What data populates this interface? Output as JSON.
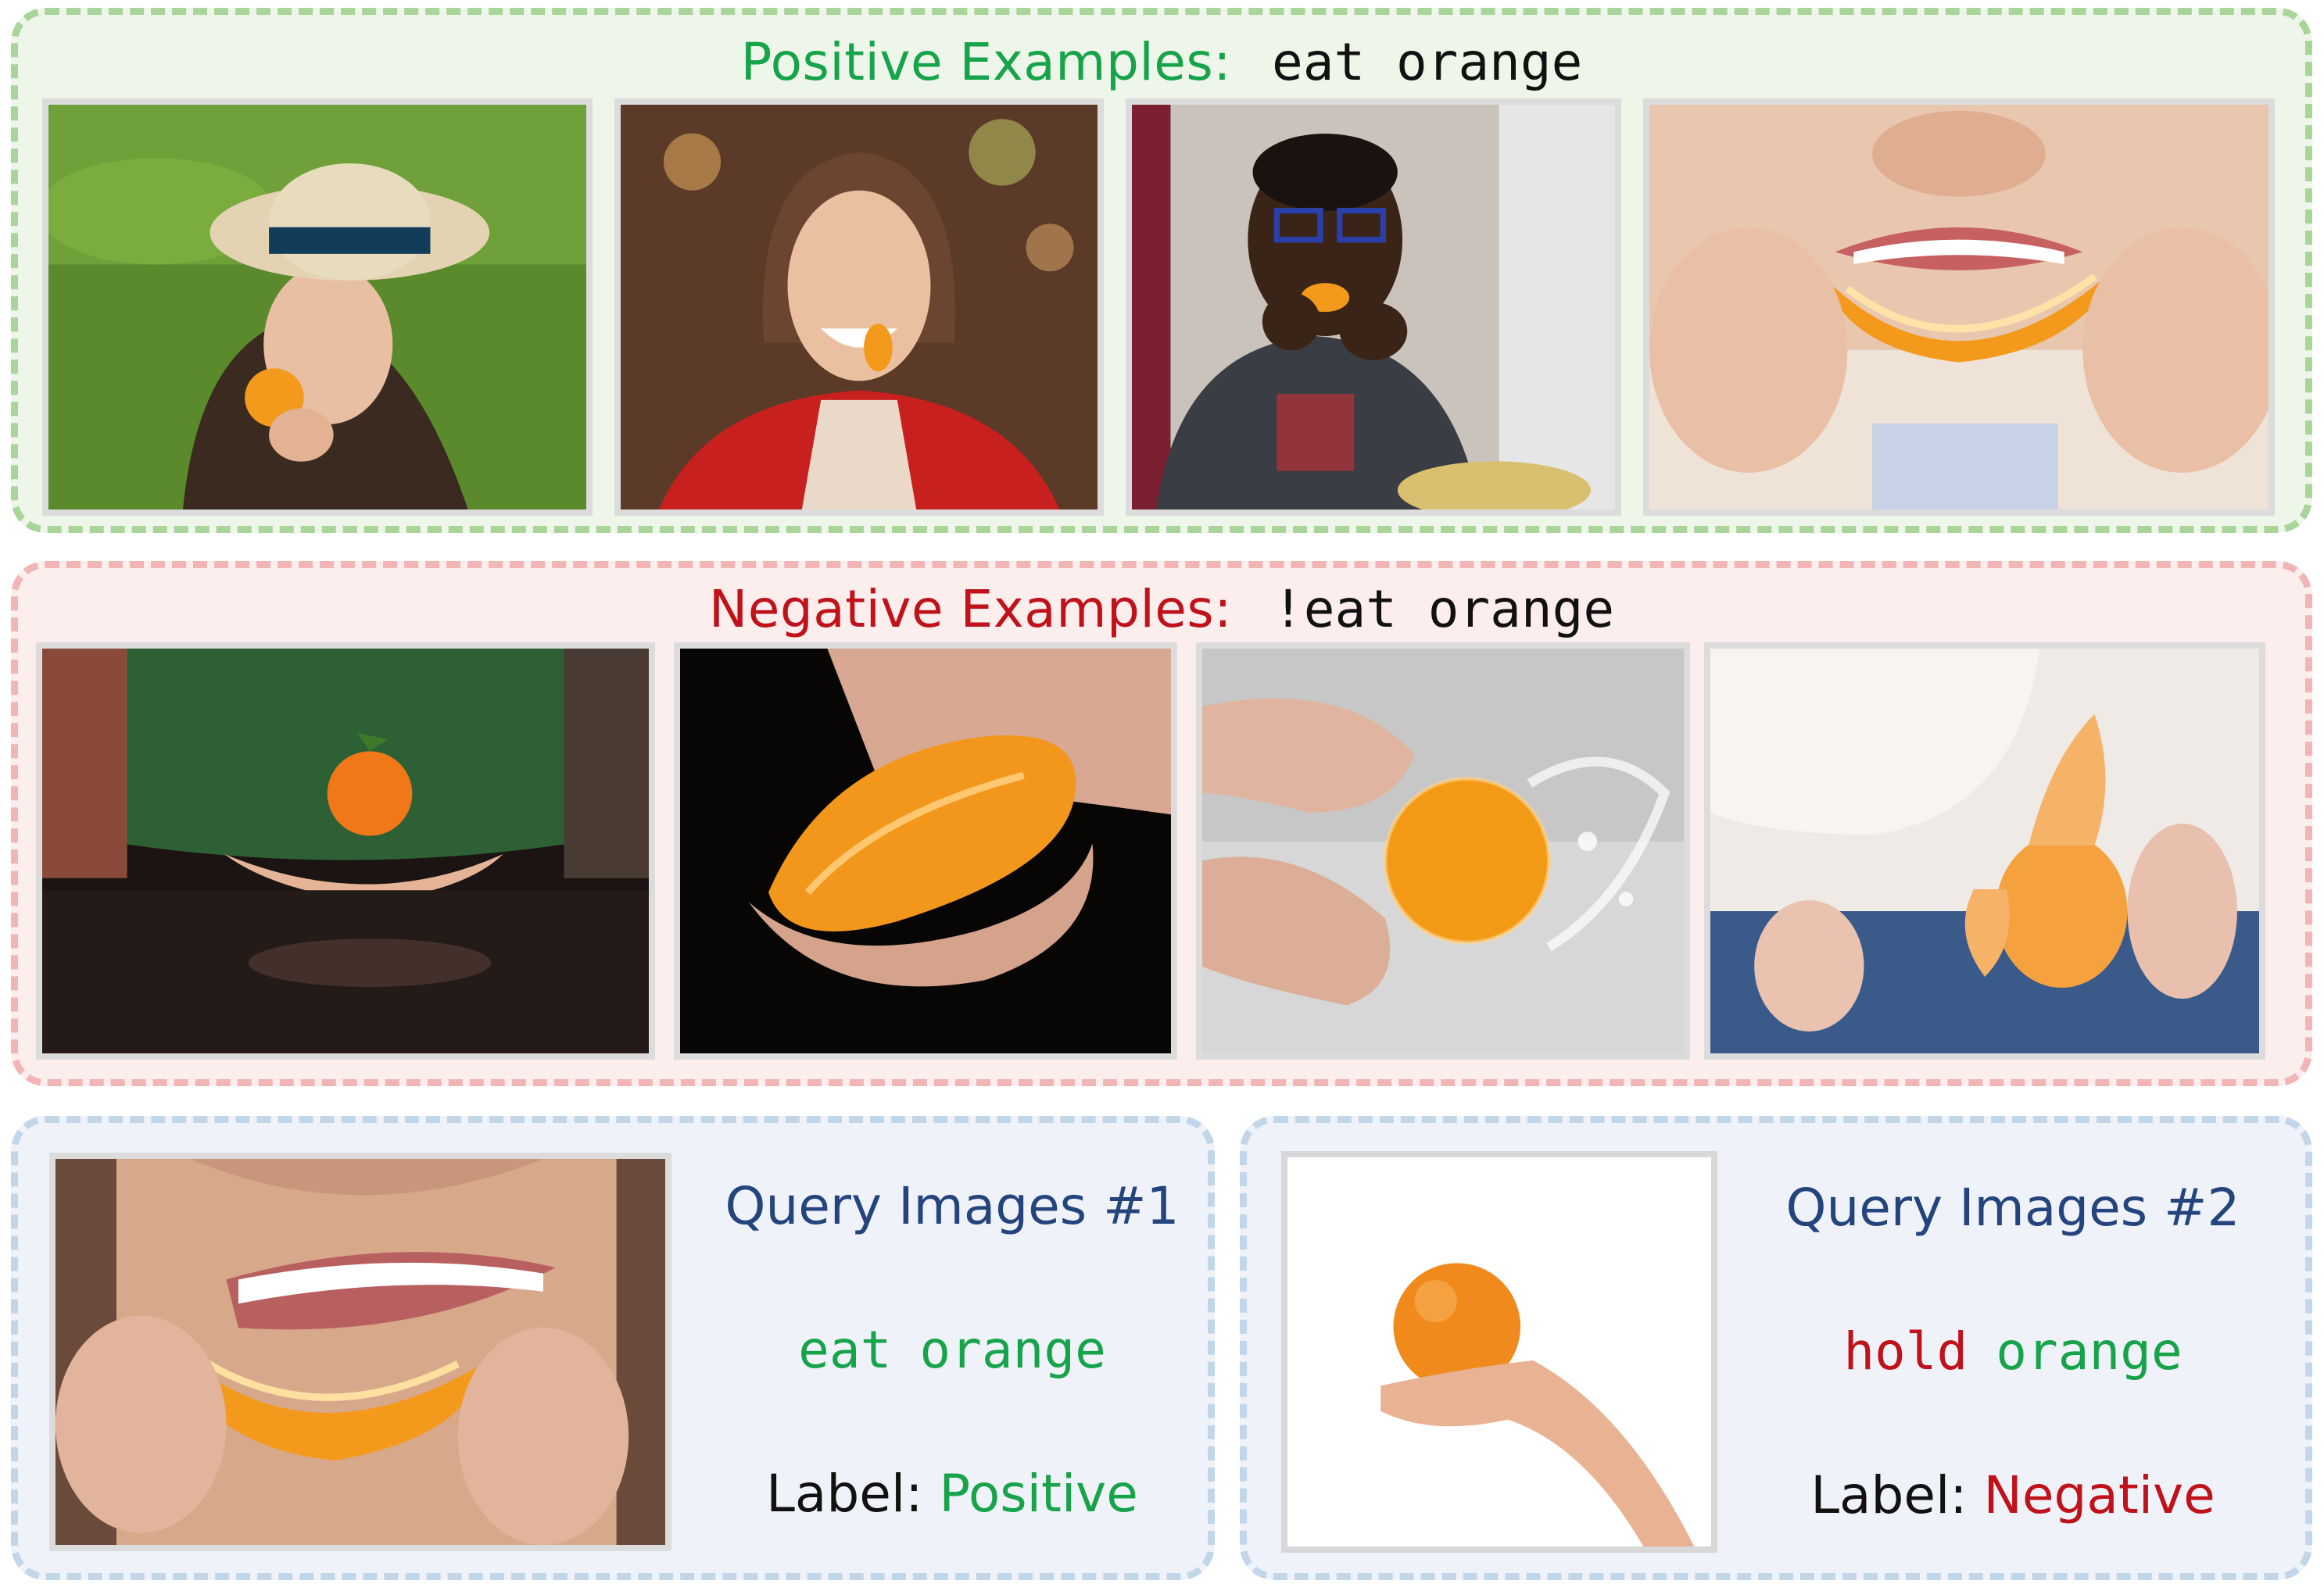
{
  "positive": {
    "label": "Positive Examples:",
    "verb": "eat orange",
    "images": [
      {
        "icon": "woman-in-hat-eating-orange-photo"
      },
      {
        "icon": "woman-eating-orange-slice-photo"
      },
      {
        "icon": "boy-with-glasses-eating-orange-photo"
      },
      {
        "icon": "mouth-biting-orange-wedge-photo"
      }
    ]
  },
  "negative": {
    "label": "Negative Examples:",
    "verb": "!eat orange",
    "images": [
      {
        "icon": "hands-holding-orange-photo"
      },
      {
        "icon": "hand-squeezing-orange-photo"
      },
      {
        "icon": "hands-washing-orange-photo"
      },
      {
        "icon": "hands-peeling-orange-photo"
      }
    ]
  },
  "query1": {
    "title": "Query Images #1",
    "verb": "eat",
    "noun": "orange",
    "label_prefix": "Label:",
    "label_value": "Positive",
    "image": {
      "icon": "smiling-mouth-biting-orange-photo"
    }
  },
  "query2": {
    "title": "Query Images #2",
    "verb": "hold",
    "noun": "orange",
    "label_prefix": "Label:",
    "label_value": "Negative",
    "image": {
      "icon": "hand-holding-orange-photo"
    }
  },
  "colors": {
    "positive": "#17a34a",
    "negative": "#c0121b",
    "query_title": "#24447e",
    "orange": "#f39a1c"
  }
}
